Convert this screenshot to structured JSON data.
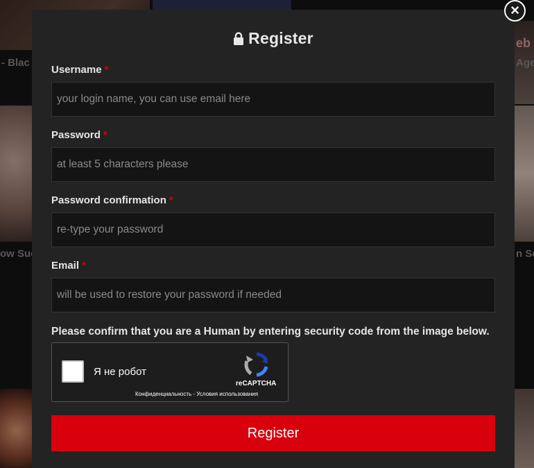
{
  "background": {
    "captions": [
      "- Blac",
      "Age",
      "ow Suc",
      "n Se"
    ],
    "watermark": "eb"
  },
  "modal": {
    "title": "Register",
    "title_icon": "lock-icon",
    "required_marker": "*",
    "fields": [
      {
        "label": "Username",
        "placeholder": "your login name, you can use email here",
        "value": ""
      },
      {
        "label": "Password",
        "placeholder": "at least 5 characters please",
        "value": ""
      },
      {
        "label": "Password confirmation",
        "placeholder": "re-type your password",
        "value": ""
      },
      {
        "label": "Email",
        "placeholder": "will be used to restore your password if needed",
        "value": ""
      }
    ],
    "captcha_prompt": "Please confirm that you are a Human by entering security code from the image below.",
    "recaptcha": {
      "label": "Я не робот",
      "brand": "reCAPTCHA",
      "links": "Конфиденциальность - Условия использования"
    },
    "submit_label": "Register",
    "close_icon": "close-icon"
  },
  "colors": {
    "accent": "#d9000d",
    "modal_bg": "#232323",
    "input_bg": "#141414"
  }
}
